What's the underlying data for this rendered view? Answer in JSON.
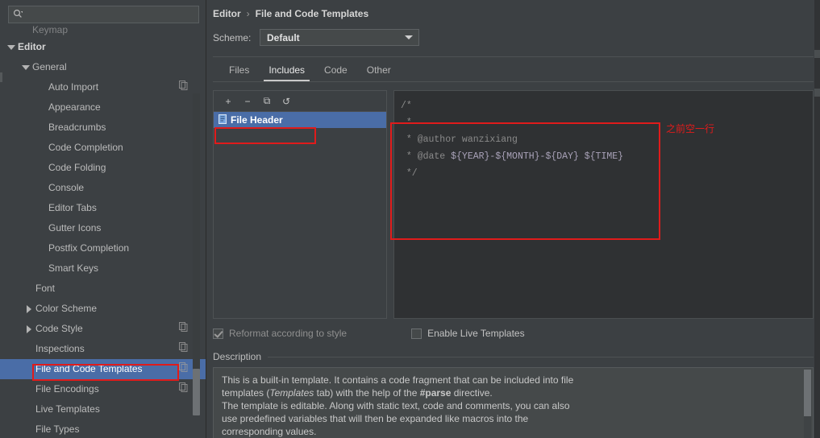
{
  "search": {
    "value": "",
    "placeholder": "",
    "icon": "search-icon"
  },
  "sidebar": {
    "clipped_item": "Keymap",
    "items": [
      {
        "label": "Editor",
        "indent": 8,
        "arrow": "down",
        "bold": true,
        "copy": false,
        "selected": false
      },
      {
        "label": "General",
        "indent": 26,
        "arrow": "down",
        "bold": false,
        "copy": false,
        "selected": false
      },
      {
        "label": "Auto Import",
        "indent": 46,
        "arrow": "none",
        "bold": false,
        "copy": true,
        "selected": false
      },
      {
        "label": "Appearance",
        "indent": 46,
        "arrow": "none",
        "bold": false,
        "copy": false,
        "selected": false
      },
      {
        "label": "Breadcrumbs",
        "indent": 46,
        "arrow": "none",
        "bold": false,
        "copy": false,
        "selected": false
      },
      {
        "label": "Code Completion",
        "indent": 46,
        "arrow": "none",
        "bold": false,
        "copy": false,
        "selected": false
      },
      {
        "label": "Code Folding",
        "indent": 46,
        "arrow": "none",
        "bold": false,
        "copy": false,
        "selected": false
      },
      {
        "label": "Console",
        "indent": 46,
        "arrow": "none",
        "bold": false,
        "copy": false,
        "selected": false
      },
      {
        "label": "Editor Tabs",
        "indent": 46,
        "arrow": "none",
        "bold": false,
        "copy": false,
        "selected": false
      },
      {
        "label": "Gutter Icons",
        "indent": 46,
        "arrow": "none",
        "bold": false,
        "copy": false,
        "selected": false
      },
      {
        "label": "Postfix Completion",
        "indent": 46,
        "arrow": "none",
        "bold": false,
        "copy": false,
        "selected": false
      },
      {
        "label": "Smart Keys",
        "indent": 46,
        "arrow": "none",
        "bold": false,
        "copy": false,
        "selected": false
      },
      {
        "label": "Font",
        "indent": 30,
        "arrow": "none",
        "bold": false,
        "copy": false,
        "selected": false
      },
      {
        "label": "Color Scheme",
        "indent": 30,
        "arrow": "right",
        "bold": false,
        "copy": false,
        "selected": false
      },
      {
        "label": "Code Style",
        "indent": 30,
        "arrow": "right",
        "bold": false,
        "copy": true,
        "selected": false
      },
      {
        "label": "Inspections",
        "indent": 30,
        "arrow": "none",
        "bold": false,
        "copy": true,
        "selected": false
      },
      {
        "label": "File and Code Templates",
        "indent": 30,
        "arrow": "none",
        "bold": false,
        "copy": true,
        "selected": true
      },
      {
        "label": "File Encodings",
        "indent": 30,
        "arrow": "none",
        "bold": false,
        "copy": true,
        "selected": false
      },
      {
        "label": "Live Templates",
        "indent": 30,
        "arrow": "none",
        "bold": false,
        "copy": false,
        "selected": false
      },
      {
        "label": "File Types",
        "indent": 30,
        "arrow": "none",
        "bold": false,
        "copy": false,
        "selected": false
      }
    ]
  },
  "header": {
    "breadcrumb_parent": "Editor",
    "breadcrumb_sep": "›",
    "breadcrumb_current": "File and Code Templates",
    "scheme_label": "Scheme:",
    "scheme_value": "Default"
  },
  "tabs": [
    {
      "label": "Files",
      "active": false
    },
    {
      "label": "Includes",
      "active": true
    },
    {
      "label": "Code",
      "active": false
    },
    {
      "label": "Other",
      "active": false
    }
  ],
  "template_list": {
    "toolbar": [
      {
        "name": "add-template-button",
        "glyph": "+"
      },
      {
        "name": "remove-template-button",
        "glyph": "−"
      },
      {
        "name": "copy-template-button",
        "glyph": "⧉"
      },
      {
        "name": "reset-template-button",
        "glyph": "↺"
      }
    ],
    "items": [
      {
        "label": "File Header",
        "selected": true
      }
    ]
  },
  "editor": {
    "lines": [
      {
        "parts": [
          {
            "t": "/*",
            "c": "kw"
          }
        ]
      },
      {
        "parts": [
          {
            "t": " *",
            "c": "kw"
          }
        ]
      },
      {
        "parts": [
          {
            "t": " * @author wanzixiang",
            "c": "kw"
          }
        ]
      },
      {
        "parts": [
          {
            "t": " * @date ",
            "c": "kw"
          },
          {
            "t": "${YEAR}-${MONTH}-${DAY} ${TIME}",
            "c": "v"
          }
        ]
      },
      {
        "parts": [
          {
            "t": " */",
            "c": "kw"
          }
        ]
      }
    ]
  },
  "options": {
    "reformat_label": "Reformat according to style",
    "reformat_checked": true,
    "live_templates_label": "Enable Live Templates",
    "live_templates_checked": false
  },
  "description": {
    "title": "Description",
    "line1_a": "This is a built-in template. It contains a code fragment that can be included into file",
    "line2_a": "templates (",
    "line2_i": "Templates",
    "line2_b": " tab) with the help of the ",
    "line2_c": "#parse",
    "line2_d": " directive.",
    "line3": "The template is editable. Along with static text, code and comments, you can also",
    "line4": "use predefined variables that will then be expanded like macros into the",
    "line5": "corresponding values."
  },
  "annotations": {
    "note_text": "之前空一行",
    "color": "#e01b1b"
  }
}
